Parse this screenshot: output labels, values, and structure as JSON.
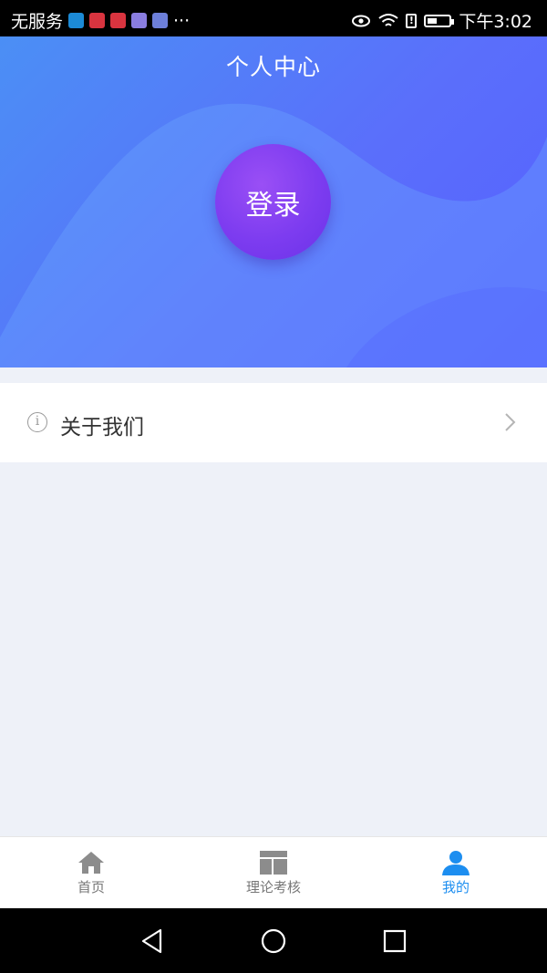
{
  "status_bar": {
    "carrier": "无服务",
    "more": "···",
    "time": "下午3:02",
    "battery_level": 0.45,
    "app_icon_colors": [
      "#1c8ad6",
      "#d9343f",
      "#d9343f",
      "#8a7de0",
      "#6d7fd9"
    ]
  },
  "header": {
    "title": "个人中心",
    "login_label": "登录"
  },
  "menu": {
    "about_label": "关于我们"
  },
  "tab_bar": {
    "items": [
      {
        "label": "首页",
        "icon": "home-icon"
      },
      {
        "label": "理论考核",
        "icon": "layout-icon"
      },
      {
        "label": "我的",
        "icon": "user-icon",
        "active": true
      }
    ]
  },
  "colors": {
    "accent": "#1d8ef0",
    "login_button": "#7d3cf0",
    "header_gradient_start": "#4b8ff5",
    "header_gradient_end": "#5660ff"
  }
}
